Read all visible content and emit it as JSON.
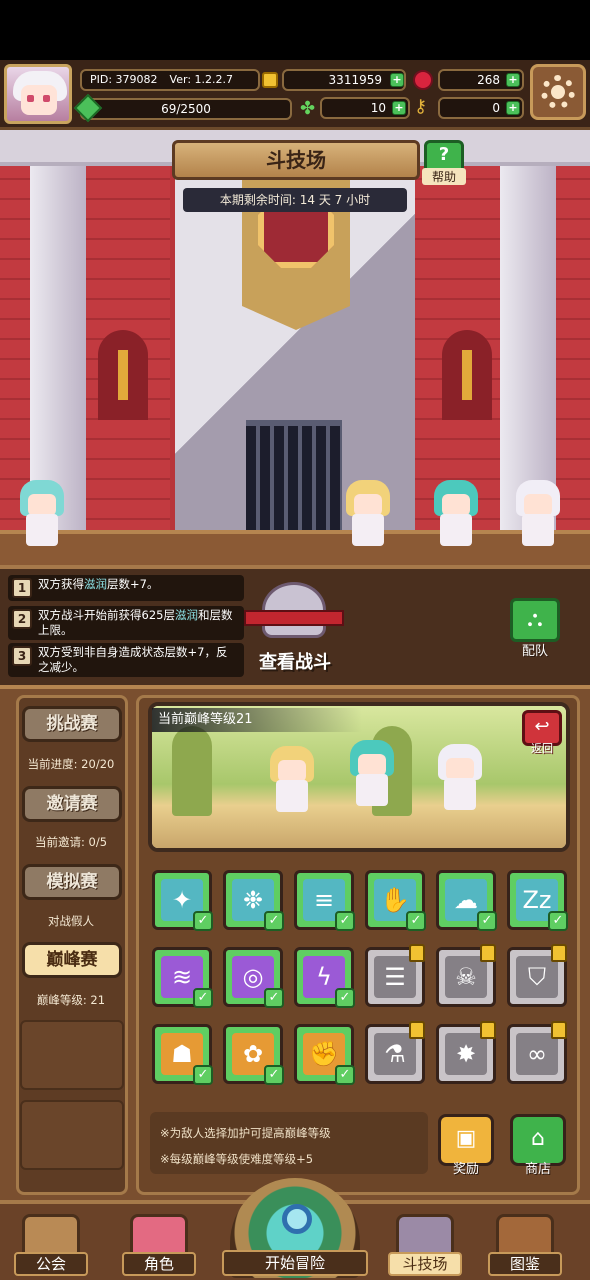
{
  "header": {
    "pid": "PID: 379082",
    "version": "Ver: 1.2.2.7",
    "gold": "3311959",
    "gems": "268",
    "exp_text": "69/2500",
    "exp_progress": 0.0276,
    "clover": "10",
    "keys": "0",
    "plus_symbol": "+"
  },
  "arena": {
    "title": "斗技场",
    "help_label": "帮助",
    "help_symbol": "?",
    "timer": "本期剩余时间: 14 天 7 小时"
  },
  "rules": [
    {
      "num": "1",
      "pre": "双方获得",
      "hl": "滋润",
      "post": "层数+7。"
    },
    {
      "num": "2",
      "pre": "双方战斗开始前获得625层",
      "hl": "滋润",
      "post": "和层数上限。"
    },
    {
      "num": "3",
      "pre": "双方受到非自身造成状态层数+7，反之减少。",
      "hl": "",
      "post": ""
    }
  ],
  "battle": {
    "view_label": "查看战斗",
    "team_label": "配队"
  },
  "sidebar": [
    {
      "label": "挑战赛",
      "info": "当前进度: 20/20",
      "active": false
    },
    {
      "label": "邀请赛",
      "info": "当前邀请: 0/5",
      "active": false
    },
    {
      "label": "模拟赛",
      "info": "对战假人",
      "active": false
    },
    {
      "label": "巅峰赛",
      "info": "巅峰等级: 21",
      "active": true
    }
  ],
  "peak": {
    "level_label": "当前巅峰等级21",
    "back_label": "返回"
  },
  "buffs": [
    [
      {
        "icon": "sparkle-icon",
        "glyph": "✦",
        "color": "#54b7c2",
        "state": "checked"
      },
      {
        "icon": "gear-burst-icon",
        "glyph": "❉",
        "color": "#54b7c2",
        "state": "checked"
      },
      {
        "icon": "tornado-icon",
        "glyph": "≡",
        "color": "#54b7c2",
        "state": "checked"
      },
      {
        "icon": "claw-icon",
        "glyph": "✋",
        "color": "#54b7c2",
        "state": "checked"
      },
      {
        "icon": "cloud-icon",
        "glyph": "☁",
        "color": "#54b7c2",
        "state": "checked"
      },
      {
        "icon": "sleep-icon",
        "glyph": "Zz",
        "color": "#54b7c2",
        "state": "checked"
      }
    ],
    [
      {
        "icon": "wave-icon",
        "glyph": "≋",
        "color": "#9b5ad6",
        "state": "checked"
      },
      {
        "icon": "vortex-icon",
        "glyph": "◎",
        "color": "#9b5ad6",
        "state": "checked"
      },
      {
        "icon": "lightning-icon",
        "glyph": "ϟ",
        "color": "#9b5ad6",
        "state": "checked"
      },
      {
        "icon": "whirlwind-icon",
        "glyph": "☰",
        "color": "#858086",
        "state": "locked"
      },
      {
        "icon": "skull-icon",
        "glyph": "☠",
        "color": "#858086",
        "state": "locked"
      },
      {
        "icon": "shield-icon",
        "glyph": "⛉",
        "color": "#858086",
        "state": "locked"
      }
    ],
    [
      {
        "icon": "ghost-icon",
        "glyph": "☗",
        "color": "#e69a34",
        "state": "checked"
      },
      {
        "icon": "wolf-icon",
        "glyph": "✿",
        "color": "#e69a34",
        "state": "checked"
      },
      {
        "icon": "fist-icon",
        "glyph": "✊",
        "color": "#e69a34",
        "state": "checked"
      },
      {
        "icon": "flask-icon",
        "glyph": "⚗",
        "color": "#858086",
        "state": "locked"
      },
      {
        "icon": "burst-icon",
        "glyph": "✸",
        "color": "#858086",
        "state": "locked"
      },
      {
        "icon": "infinity-icon",
        "glyph": "∞",
        "color": "#858086",
        "state": "locked"
      }
    ]
  ],
  "notes": [
    "※为敌人选择加护可提高巅峰等级",
    "※每级巅峰等级使难度等级+5"
  ],
  "actions": {
    "reward_label": "奖励",
    "shop_label": "商店"
  },
  "nav": {
    "guild": "公会",
    "character": "角色",
    "adventure": "开始冒险",
    "arena": "斗技场",
    "codex": "图鉴"
  }
}
